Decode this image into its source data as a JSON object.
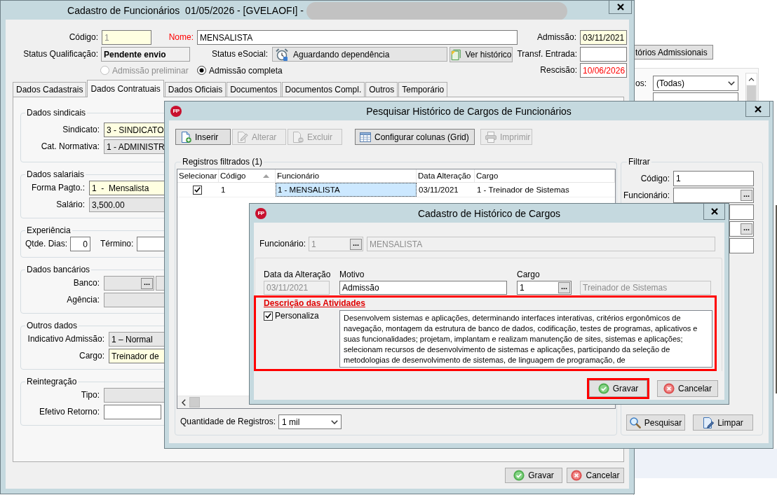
{
  "main_window": {
    "title": "Cadastro de Funcionários  01/05/2026 - [GVELAOFI] -",
    "header": {
      "codigo": {
        "label": "Código:",
        "value": "1",
        "kind": "highlighted",
        "disabled": true
      },
      "nome": {
        "label": "Nome:",
        "value": "MENSALISTA",
        "kind": "text",
        "required": true
      },
      "admissao": {
        "label": "Admissão:",
        "value": "03/11/2021",
        "kind": "highlighted"
      },
      "status_qualificacao": {
        "label": "Status Qualificação:",
        "value": "Pendente envio",
        "kind": "readonly"
      },
      "status_esocial": {
        "label": "Status eSocial:",
        "value": "Aguardando dependência"
      },
      "ver_historico": {
        "label": "Ver histórico"
      },
      "transf_entrada": {
        "label": "Transf. Entrada:",
        "kind": "text"
      },
      "admission_type": [
        {
          "label": "Admissão preliminar",
          "selected": false,
          "disabled": true
        },
        {
          "label": "Admissão completa",
          "selected": true,
          "disabled": false
        }
      ],
      "rescisao": {
        "label": "Rescisão:",
        "value": "10/06/2026",
        "kind": "text",
        "alert": true
      }
    },
    "tabs": [
      {
        "label": "Dados Cadastrais",
        "selected": false
      },
      {
        "label": "Dados Contratuais",
        "selected": true
      },
      {
        "label": "Dados Oficiais",
        "selected": false
      },
      {
        "label": "Documentos",
        "selected": false
      },
      {
        "label": "Documentos Compl.",
        "selected": false
      },
      {
        "label": "Outros",
        "selected": false
      },
      {
        "label": "Temporário",
        "selected": false
      }
    ],
    "sections": [
      {
        "title": "Dados sindicais",
        "kind": "stacked",
        "fields": [
          {
            "label": "Sindicato:",
            "value": "3 - SINDICATO",
            "kind": "highlighted"
          },
          {
            "label": "Cat. Normativa:",
            "value": "1 - ADMINISTR",
            "kind": "readonly"
          }
        ]
      },
      {
        "title": "Dados salariais",
        "kind": "stacked",
        "fields": [
          {
            "label": "Forma Pagto.:",
            "value": "1  -  Mensalista",
            "kind": "highlighted"
          },
          {
            "label": "Salário:",
            "value": "3,500.00",
            "kind": "readonly"
          }
        ]
      },
      {
        "title": "Experiência",
        "kind": "inline",
        "fields": [
          {
            "label": "Qtde. Dias:",
            "value": "0",
            "kind": "number"
          },
          {
            "label": "Término:",
            "kind": "date"
          }
        ]
      },
      {
        "title": "Dados bancários",
        "kind": "stacked",
        "fields": [
          {
            "label": "Banco:",
            "kind": "lookup",
            "button": "...",
            "disabled": true
          },
          {
            "label": "Agência:",
            "kind": "readonly"
          }
        ]
      },
      {
        "title": "Outros dados",
        "kind": "stacked",
        "fields": [
          {
            "label": "Indicativo Admissão:",
            "value": "1 – Normal",
            "kind": "readonly"
          },
          {
            "label": "Cargo:",
            "value": "Treinador de",
            "kind": "highlighted"
          }
        ]
      },
      {
        "title": "Reintegração",
        "kind": "stacked",
        "fields": [
          {
            "label": "Tipo:",
            "kind": "readonly"
          },
          {
            "label": "Efetivo Retorno:",
            "kind": "date"
          }
        ]
      }
    ],
    "buttons": [
      {
        "label": "Gravar",
        "kind": "save"
      },
      {
        "label": "Cancelar",
        "kind": "cancel"
      }
    ]
  },
  "background_window": {
    "button": "tórios Admissionais",
    "filter_label": "os:",
    "dropdown": "(Todas)"
  },
  "search_dialog": {
    "logo": "FP",
    "title": "Pesquisar Histórico de Cargos de Funcionários",
    "toolbar": [
      {
        "label": "Inserir",
        "kind": "insert",
        "disabled": false
      },
      {
        "label": "Alterar",
        "kind": "edit",
        "disabled": true
      },
      {
        "label": "Excluir",
        "kind": "delete",
        "disabled": true
      },
      {
        "label": "Configurar colunas (Grid)",
        "kind": "columns",
        "disabled": false
      },
      {
        "label": "Imprimir",
        "kind": "print",
        "disabled": true
      }
    ],
    "results": {
      "title": "Registros filtrados (1)",
      "columns": [
        {
          "label": "Selecionar",
          "sorted": false
        },
        {
          "label": "Código",
          "sorted": true
        },
        {
          "label": "Funcionário",
          "sorted": false
        },
        {
          "label": "Data Alteração",
          "sorted": false
        },
        {
          "label": "Cargo",
          "sorted": false
        }
      ],
      "rows": [
        {
          "cells": [
            {
              "kind": "checkbox",
              "checked": true
            },
            {
              "kind": "text",
              "text": "1",
              "focused": false
            },
            {
              "kind": "text",
              "text": "1 - MENSALISTA",
              "focused": true
            },
            {
              "kind": "text",
              "text": "03/11/2021",
              "focused": false
            },
            {
              "kind": "text",
              "text": "1 - Treinador de Sistemas",
              "focused": false
            }
          ]
        }
      ],
      "quantity": {
        "label": "Quantidade de Registros:",
        "value": "1 mil"
      }
    },
    "filter": {
      "title": "Filtrar",
      "fields": [
        {
          "label": "Código:",
          "value": "1",
          "kind": "labeled"
        },
        {
          "label": "Funcionário:",
          "kind": "labeled",
          "button": "..."
        },
        {
          "kind": "partial"
        },
        {
          "kind": "partial",
          "button": "..."
        },
        {
          "kind": "partial"
        }
      ],
      "buttons": [
        {
          "label": "Pesquisar",
          "kind": "search"
        },
        {
          "label": "Limpar",
          "kind": "clear"
        }
      ]
    }
  },
  "history_dialog": {
    "logo": "FP",
    "title": "Cadastro de Histórico de Cargos",
    "funcionario": {
      "label": "Funcionário:",
      "code": "1",
      "button": "...",
      "name": "MENSALISTA",
      "disabled": true
    },
    "fields": [
      {
        "label": "Data da Alteração",
        "value": "03/11/2021",
        "kind": "readonly",
        "disabled": true
      },
      {
        "label": "Motivo",
        "value": "Admissão",
        "kind": "text"
      },
      {
        "label": "Cargo",
        "value": "1",
        "kind": "lookup",
        "button": "...",
        "name": "Treinador de Sistemas"
      }
    ],
    "description": {
      "title": "Descrição das Atividades",
      "highlighted": true,
      "personaliza": {
        "label": "Personaliza",
        "checked": true
      },
      "text": "Desenvolvem sistemas e aplicações, determinando interfaces interativas, critérios ergonômicos de navegação, montagem da estrutura de banco de dados, codificação, testes de programas, aplicativos e suas funcionalidades; projetam, implantam e realizam manutenção de sites, sistemas e aplicações; selecionam recursos de desenvolvimento de sistemas e aplicações, participando da seleção de metodologias de desenvolvimento de sistemas, de linguagem de programação, de"
    },
    "buttons": [
      {
        "label": "Gravar",
        "kind": "save",
        "highlighted": true
      },
      {
        "label": "Cancelar",
        "kind": "cancel",
        "highlighted": false
      }
    ]
  }
}
